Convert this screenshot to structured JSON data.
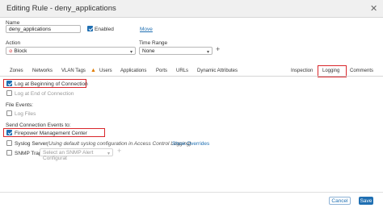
{
  "window": {
    "title": "Editing Rule - deny_applications"
  },
  "form": {
    "name_label": "Name",
    "name_value": "deny_applications",
    "enabled_label": "Enabled",
    "move_link": "Move",
    "action_label": "Action",
    "action_value": "Block",
    "time_range_label": "Time Range",
    "time_range_value": "None",
    "add_symbol": "+"
  },
  "tabs": [
    {
      "label": "Zones"
    },
    {
      "label": "Networks"
    },
    {
      "label": "VLAN Tags"
    },
    {
      "label": "Users"
    },
    {
      "label": "Applications"
    },
    {
      "label": "Ports"
    },
    {
      "label": "URLs"
    },
    {
      "label": "Dynamic Attributes"
    },
    {
      "label": "Inspection"
    },
    {
      "label": "Logging"
    },
    {
      "label": "Comments"
    }
  ],
  "logging": {
    "log_beginning": "Log at Beginning of Connection",
    "log_end": "Log at End of Connection",
    "file_events_label": "File Events:",
    "log_files": "Log Files",
    "send_events_label": "Send Connection Events to:",
    "fmc": "Firepower Management Center",
    "syslog_server": "Syslog Server",
    "syslog_note": "(Using default syslog configuration in Access Control Logging)",
    "show_overrides": "Show Overrides",
    "snmp_trap": "SNMP Trap",
    "snmp_placeholder": "Select an SNMP Alert Configurat",
    "plus": "+"
  },
  "footer": {
    "cancel": "Cancel",
    "save": "Save"
  },
  "colors": {
    "accent": "#1f6fb2",
    "highlight": "#d9262b",
    "warning": "#e07b00"
  }
}
